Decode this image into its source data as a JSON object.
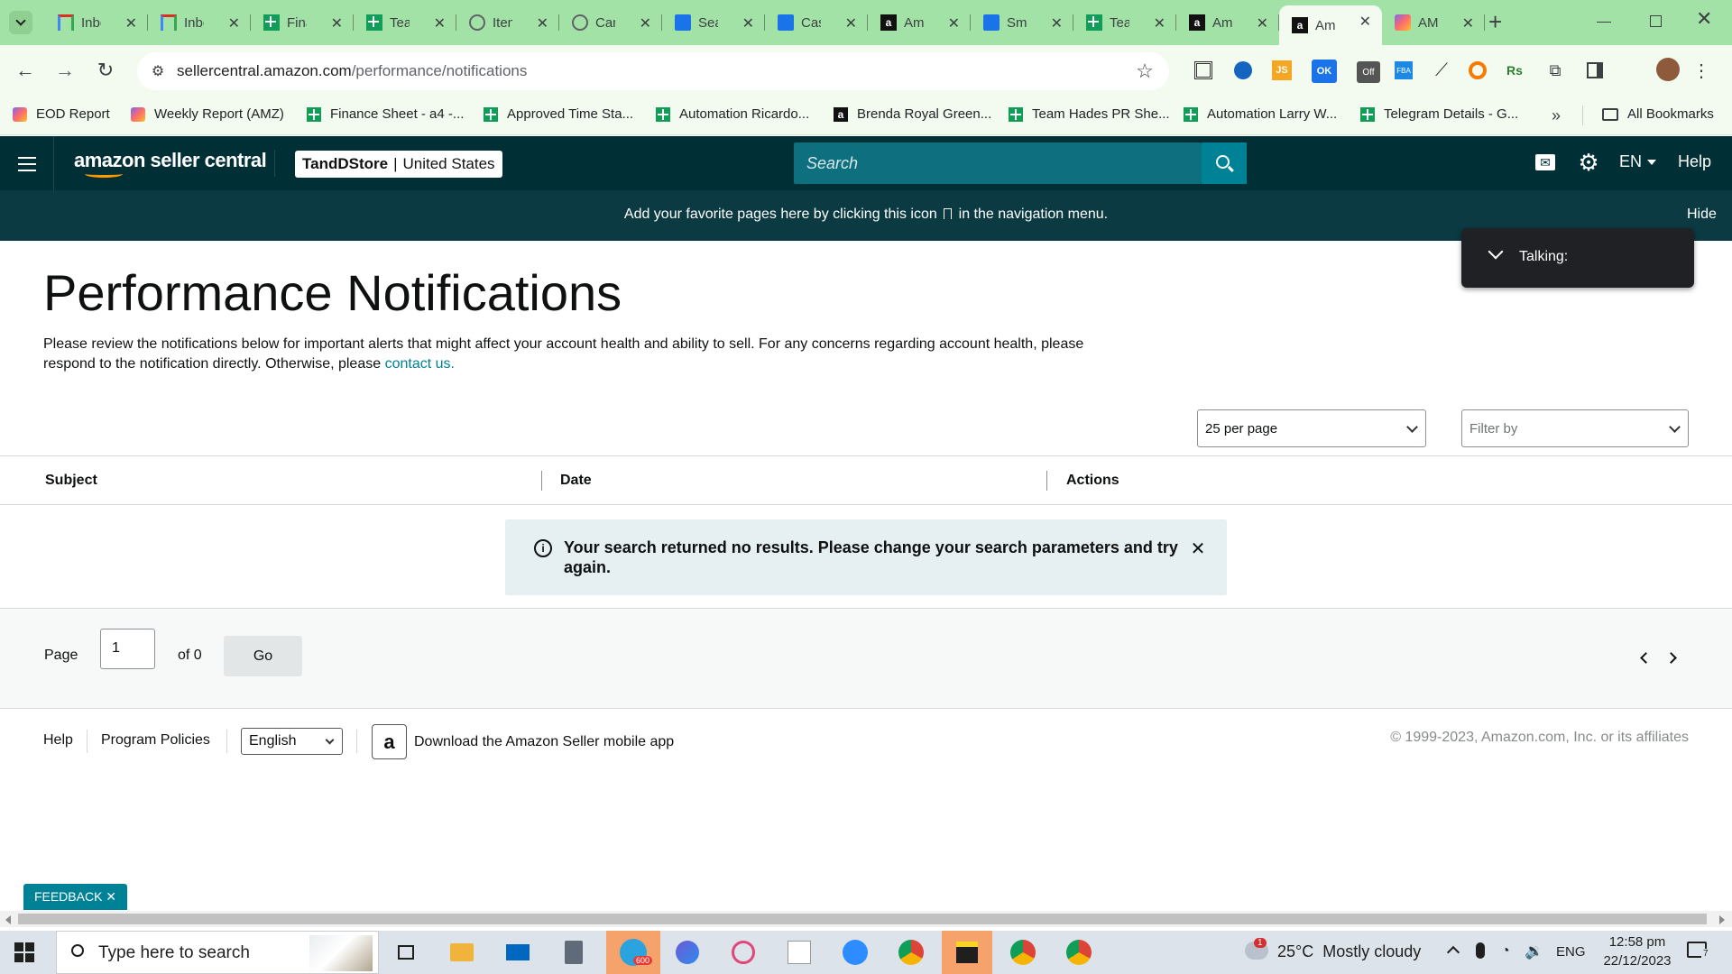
{
  "browser": {
    "tabs": [
      {
        "title": "Inbox",
        "icon": "gmail-icon",
        "color": "#d93025"
      },
      {
        "title": "Inbox",
        "icon": "gmail-icon",
        "color": "#d93025"
      },
      {
        "title": "Finance",
        "icon": "google-sheets-icon",
        "color": "#0f9d58"
      },
      {
        "title": "Team",
        "icon": "google-sheets-icon",
        "color": "#0f9d58"
      },
      {
        "title": "Items",
        "icon": "globe-icon",
        "color": "#5f6368"
      },
      {
        "title": "Can",
        "icon": "globe-icon",
        "color": "#5f6368"
      },
      {
        "title": "Sea",
        "icon": "mountain-icon",
        "color": "#1a73e8"
      },
      {
        "title": "Cas",
        "icon": "mountain-icon",
        "color": "#1a73e8"
      },
      {
        "title": "Am",
        "icon": "amazon-icon",
        "color": "#111"
      },
      {
        "title": "Sm",
        "icon": "mountain-icon",
        "color": "#1a73e8"
      },
      {
        "title": "Tea",
        "icon": "google-sheets-icon",
        "color": "#0f9d58"
      },
      {
        "title": "Am",
        "icon": "amazon-icon",
        "color": "#111"
      },
      {
        "title": "Am",
        "icon": "amazon-icon",
        "color": "#111",
        "active": true
      },
      {
        "title": "AM",
        "icon": "clickup-icon",
        "color": "#7b68ee"
      }
    ],
    "url_domain": "sellercentral.amazon.com",
    "url_path": "/performance/notifications",
    "bookmarks": [
      {
        "label": "EOD Report",
        "icon": "clickup-icon"
      },
      {
        "label": "Weekly Report (AMZ)",
        "icon": "clickup-icon"
      },
      {
        "label": "Finance Sheet - a4 -...",
        "icon": "google-sheets-icon"
      },
      {
        "label": "Approved Time Sta...",
        "icon": "google-sheets-icon"
      },
      {
        "label": "Automation Ricardo...",
        "icon": "google-sheets-icon"
      },
      {
        "label": "Brenda Royal Green...",
        "icon": "amazon-icon"
      },
      {
        "label": "Team Hades PR She...",
        "icon": "google-sheets-icon"
      },
      {
        "label": "Automation Larry W...",
        "icon": "google-sheets-icon"
      },
      {
        "label": "Telegram Details - G...",
        "icon": "google-sheets-icon"
      }
    ],
    "all_bookmarks": "All Bookmarks"
  },
  "header": {
    "logo": "amazon seller central",
    "store_name": "TandDStore",
    "store_region": "United States",
    "search_placeholder": "Search",
    "language": "EN",
    "help": "Help"
  },
  "banner": {
    "text_before": "Add your favorite pages here by clicking this icon",
    "text_after": "in the navigation menu.",
    "hide": "Hide"
  },
  "talking_popup": "Talking:",
  "page": {
    "title": "Performance Notifications",
    "description_1": "Please review the notifications below for important alerts that might affect your account health and ability to sell. For any concerns regarding account health, please",
    "description_2": "respond to the notification directly. Otherwise, please",
    "contact_link": "contact us.",
    "per_page": "25 per page",
    "filter_placeholder": "Filter by",
    "columns": [
      "Subject",
      "Date",
      "Actions"
    ],
    "no_results_1": "Your search returned no results. Please change your search parameters and try",
    "no_results_2": "again.",
    "pagination": {
      "page_label": "Page",
      "page_value": "1",
      "of_label": "of 0",
      "go": "Go"
    }
  },
  "footer": {
    "help": "Help",
    "program_policies": "Program Policies",
    "language": "English",
    "app_download": "Download the Amazon Seller mobile app",
    "copyright": "© 1999-2023, Amazon.com, Inc. or its affiliates"
  },
  "feedback": "FEEDBACK ✕",
  "taskbar": {
    "search_placeholder": "Type here to search",
    "weather": "25°C  Mostly cloudy",
    "lang": "ENG",
    "time": "12:58 pm",
    "date": "22/12/2023",
    "notification_count": "7",
    "telegram_badge": "600",
    "weather_badge": "1"
  },
  "colors": {
    "header_bg": "#002f36",
    "banner_bg": "#0b3a43",
    "search_btn": "#008296",
    "link": "#008296",
    "alert_bg": "#e6f0f2",
    "tabbar_bg": "#a3e2a6"
  }
}
